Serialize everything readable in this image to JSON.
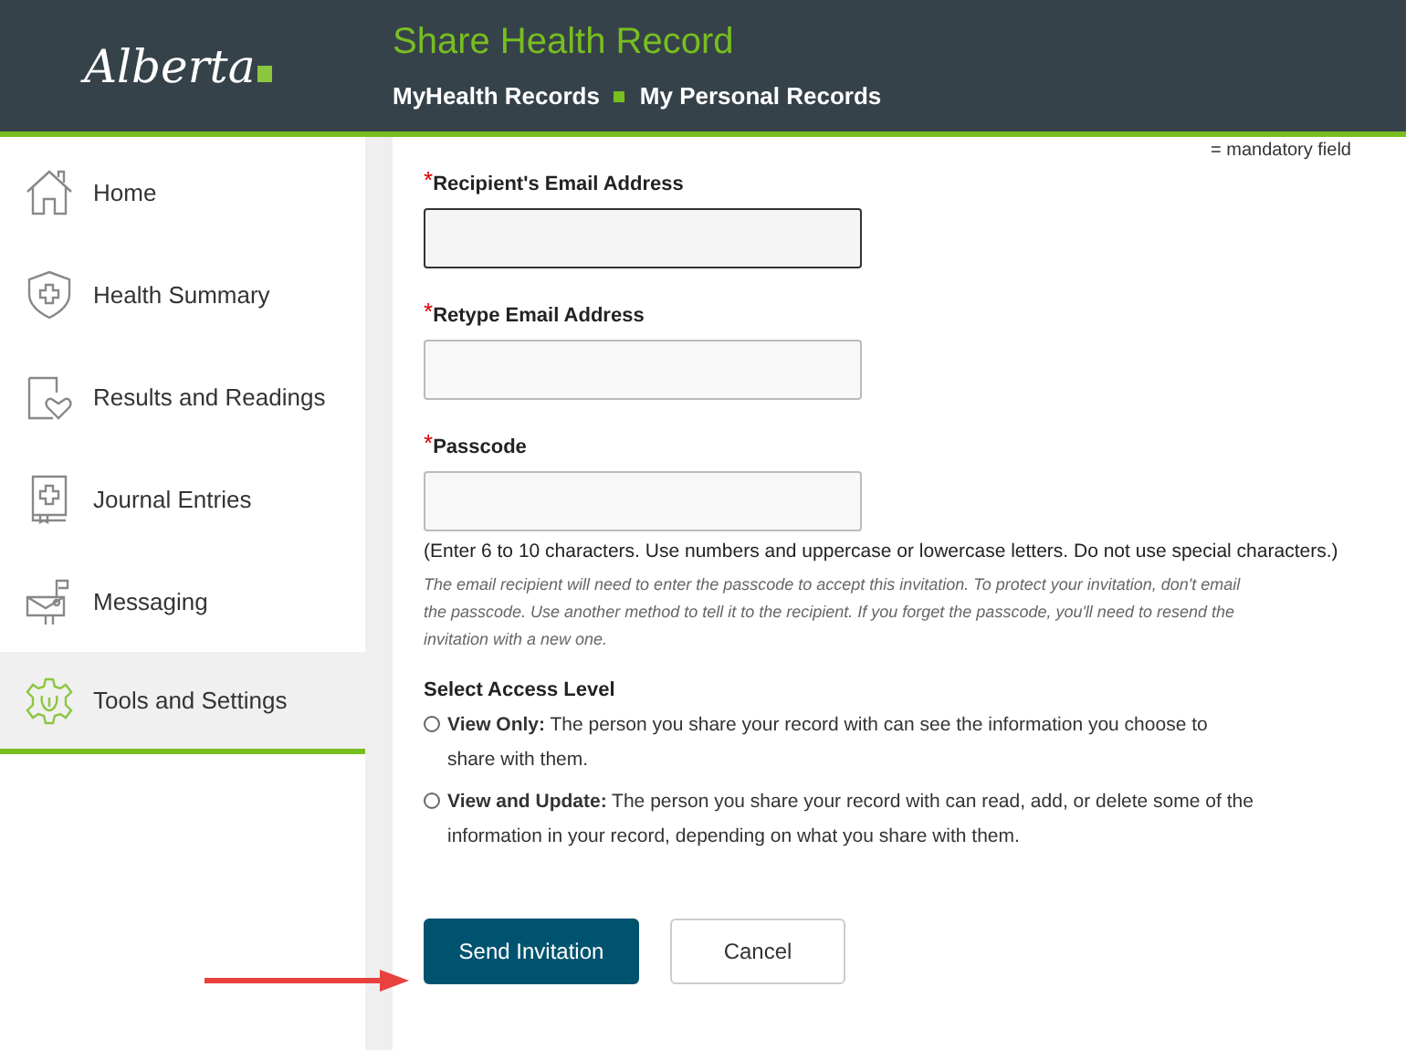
{
  "header": {
    "logo": "Alberta",
    "title": "Share Health Record",
    "breadcrumbs": [
      "MyHealth Records",
      "My Personal Records"
    ]
  },
  "sidebar": {
    "items": [
      {
        "label": "Home",
        "kind": "house",
        "selected": false
      },
      {
        "label": "Health Summary",
        "kind": "shield",
        "selected": false
      },
      {
        "label": "Results and Readings",
        "kind": "document",
        "selected": false
      },
      {
        "label": "Journal Entries",
        "kind": "book",
        "selected": false
      },
      {
        "label": "Messaging",
        "kind": "mailbox",
        "selected": false
      },
      {
        "label": "Tools and Settings",
        "kind": "gear",
        "selected": true
      }
    ]
  },
  "form": {
    "mandatory_note": "= mandatory field",
    "fields": [
      {
        "label": "Recipient's Email Address",
        "required_mark": "*",
        "focused": true
      },
      {
        "label": "Retype Email Address",
        "required_mark": "*",
        "focused": false
      },
      {
        "label": "Passcode",
        "required_mark": "*",
        "focused": false
      }
    ],
    "passcode_hint": "(Enter 6 to 10 characters. Use numbers and uppercase or lowercase letters. Do not use special characters.)",
    "passcode_note": "The email recipient will need to enter the passcode to accept this invitation. To protect your invitation, don't email the passcode. Use another method to tell it to the recipient. If you forget the passcode, you'll need to resend the invitation with a new one.",
    "access_heading": "Select Access Level",
    "access_options": [
      {
        "text": "**View Only:** The person you share your record with can see the information you choose to share with them.",
        "selected": false
      },
      {
        "text": "**View and Update:** The person you share your record with can read, add, or delete some of the information in your record, depending on what you share with them.",
        "selected": false
      }
    ],
    "buttons": [
      {
        "label": "Send Invitation",
        "kind": "primary"
      },
      {
        "label": "Cancel",
        "kind": "secondary"
      }
    ]
  }
}
